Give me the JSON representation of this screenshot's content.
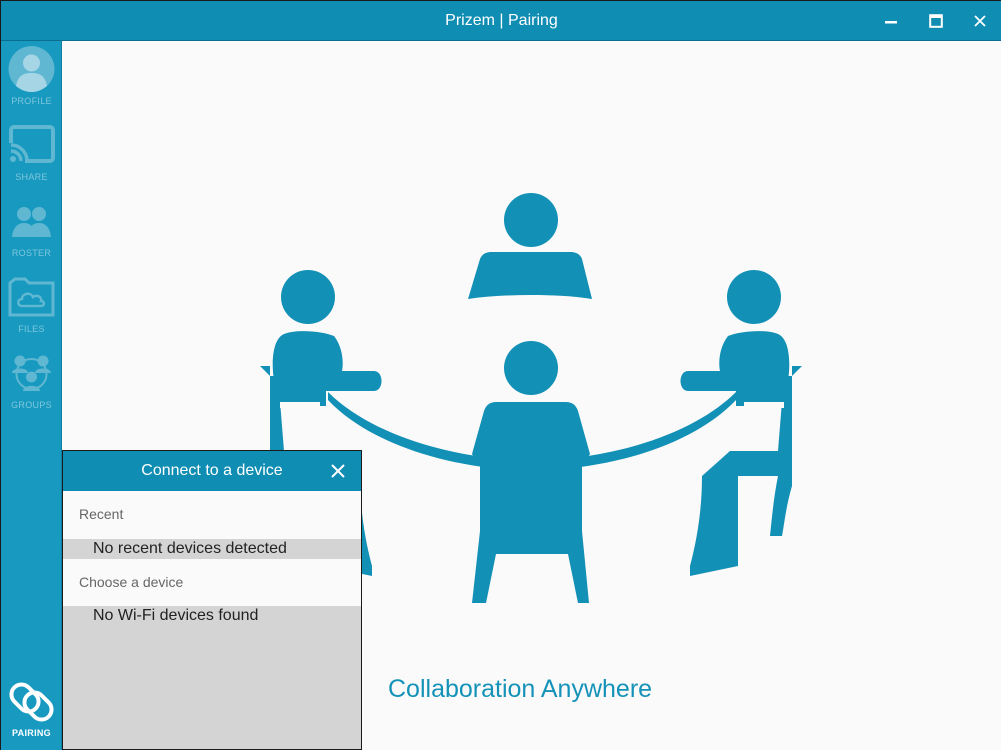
{
  "window": {
    "title": "Prizem | Pairing",
    "controls": {
      "minimize_icon": "minimize-icon",
      "maximize_icon": "maximize-icon",
      "close_icon": "close-icon"
    }
  },
  "sidebar": {
    "items": [
      {
        "label": "PROFILE",
        "icon": "profile-icon",
        "active": false
      },
      {
        "label": "SHARE",
        "icon": "cast-icon",
        "active": false
      },
      {
        "label": "ROSTER",
        "icon": "people-icon",
        "active": false
      },
      {
        "label": "FILES",
        "icon": "cloud-folder-icon",
        "active": false
      },
      {
        "label": "GROUPS",
        "icon": "groups-icon",
        "active": false
      },
      {
        "label": "PAIRING",
        "icon": "link-icon",
        "active": true
      }
    ]
  },
  "main": {
    "illustration": "meeting-table-illustration",
    "tagline": "Collaboration Anywhere"
  },
  "dialog": {
    "title": "Connect to a device",
    "recent_header": "Recent",
    "recent_empty": "No recent devices detected",
    "choose_header": "Choose a device",
    "choose_empty": "No Wi-Fi devices found"
  },
  "colors": {
    "accent": "#0f8db3",
    "sidebar": "#1799c0",
    "illustration": "#1290b6",
    "background": "#fafafa",
    "list_background": "#d4d4d4"
  }
}
